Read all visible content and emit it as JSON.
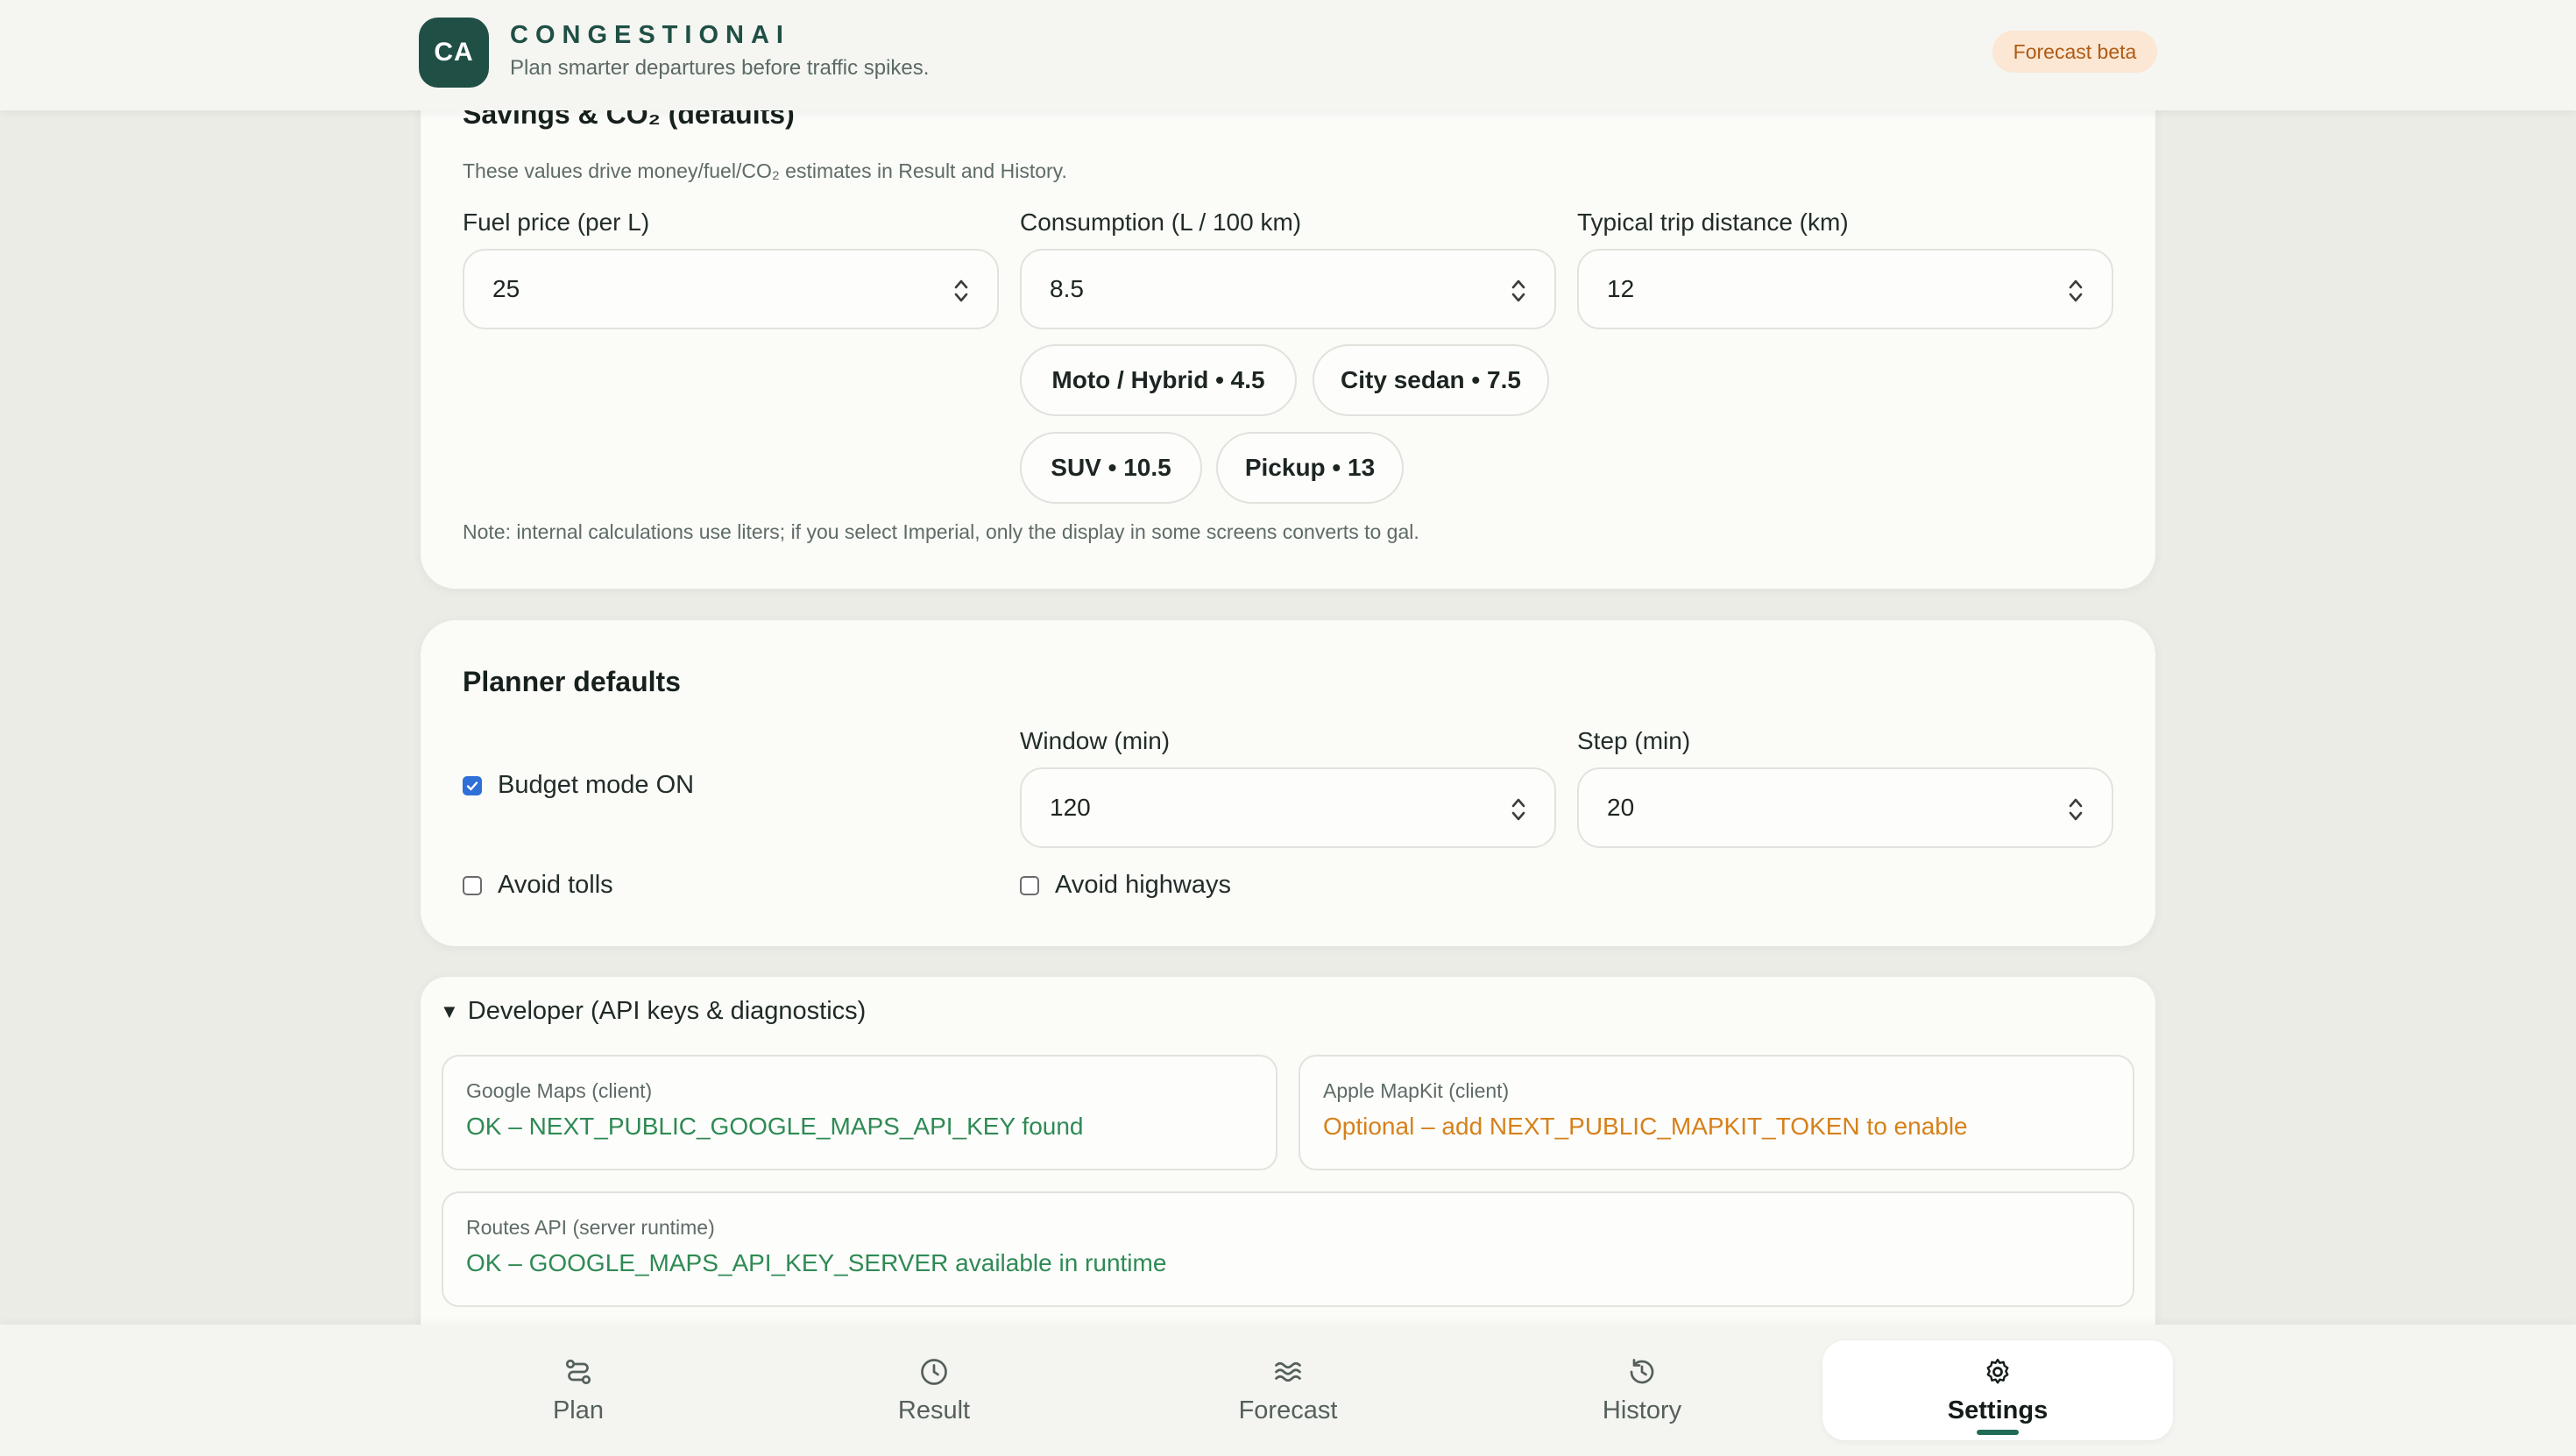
{
  "header": {
    "badge": "CA",
    "brand": "CONGESTIONAI",
    "tagline": "Plan smarter departures before traffic spikes.",
    "beta": "Forecast beta"
  },
  "savings": {
    "title": "Savings & CO₂ (defaults)",
    "hint": "These values drive money/fuel/CO₂ estimates in Result and History.",
    "fuel_label": "Fuel price (per L)",
    "fuel_value": "25",
    "consumption_label": "Consumption (L / 100 km)",
    "consumption_value": "8.5",
    "distance_label": "Typical trip distance (km)",
    "distance_value": "12",
    "presets": [
      "Moto / Hybrid • 4.5",
      "City sedan • 7.5",
      "SUV • 10.5",
      "Pickup • 13"
    ],
    "note": "Note: internal calculations use liters; if you select Imperial, only the display in some screens converts to gal."
  },
  "planner": {
    "title": "Planner defaults",
    "budget_label": "Budget mode ON",
    "budget_checked": true,
    "window_label": "Window (min)",
    "window_value": "120",
    "step_label": "Step (min)",
    "step_value": "20",
    "tolls_label": "Avoid tolls",
    "tolls_checked": false,
    "highways_label": "Avoid highways",
    "highways_checked": false
  },
  "developer": {
    "summary": "Developer (API keys & diagnostics)",
    "google_label": "Google Maps (client)",
    "google_status": "OK – NEXT_PUBLIC_GOOGLE_MAPS_API_KEY found",
    "apple_label": "Apple MapKit (client)",
    "apple_status": "Optional – add NEXT_PUBLIC_MAPKIT_TOKEN to enable",
    "routes_label": "Routes API (server runtime)",
    "routes_status": "OK – GOOGLE_MAPS_API_KEY_SERVER available in runtime"
  },
  "nav": {
    "items": [
      "Plan",
      "Result",
      "Forecast",
      "History",
      "Settings"
    ],
    "active": "Settings"
  },
  "colors": {
    "brand": "#1f4f45",
    "ok": "#2f8a55",
    "warn": "#d6811b",
    "checkbox": "#2f6fd8"
  }
}
